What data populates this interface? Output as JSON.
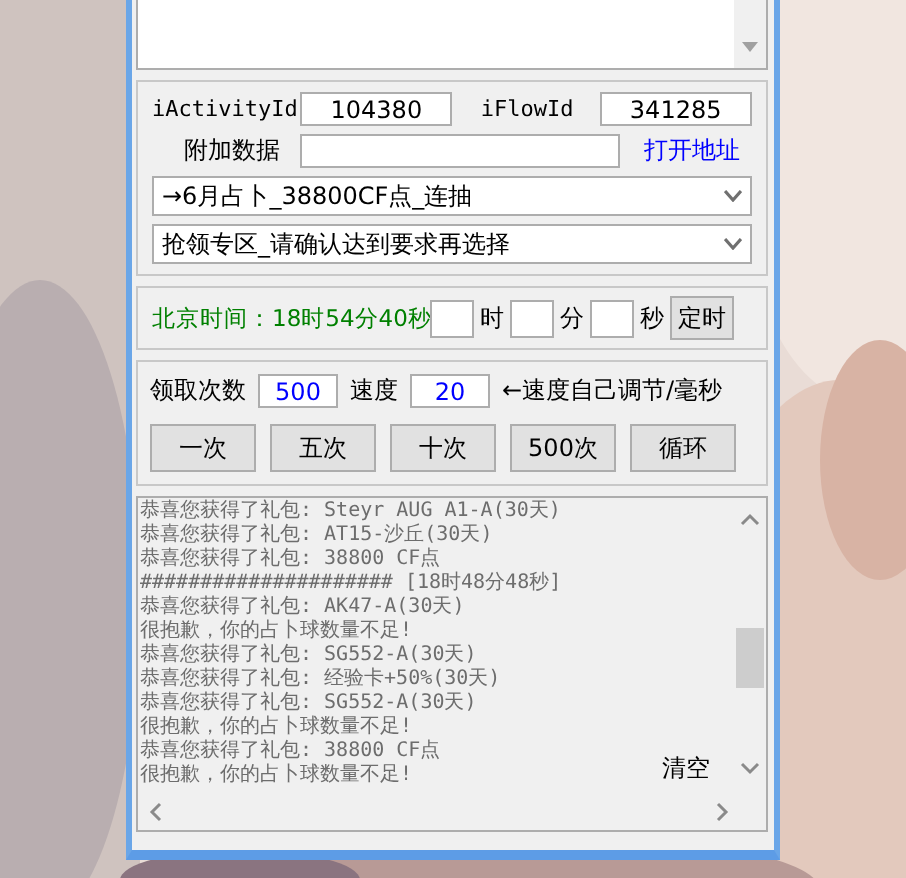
{
  "activity_row": {
    "activity_label": "iActivityId",
    "activity_value": "104380",
    "flow_label": "iFlowId",
    "flow_value": "341285"
  },
  "extra_row": {
    "label": "附加数据",
    "link": "打开地址"
  },
  "dropdowns": [
    "→6月占卜_38800CF点_连抽",
    "抢领专区_请确认达到要求再选择"
  ],
  "timer": {
    "clock": "北京时间：18时54分40秒",
    "units": [
      "时",
      "分",
      "秒"
    ],
    "button": "定时"
  },
  "claim": {
    "count_label": "领取次数",
    "count_value": "500",
    "speed_label": "速度",
    "speed_value": "20",
    "hint": "←速度自己调节/毫秒"
  },
  "buttons": [
    "一次",
    "五次",
    "十次",
    "500次",
    "循环"
  ],
  "log": {
    "lines": [
      "恭喜您获得了礼包:  Steyr AUG A1-A(30天)",
      "恭喜您获得了礼包:  AT15-沙丘(30天)",
      "恭喜您获得了礼包:  38800 CF点",
      "##################### [18时48分48秒]",
      "恭喜您获得了礼包:  AK47-A(30天)",
      "很抱歉，你的占卜球数量不足!",
      "恭喜您获得了礼包:  SG552-A(30天)",
      "恭喜您获得了礼包:  经验卡+50%(30天)",
      "恭喜您获得了礼包:  SG552-A(30天)",
      "很抱歉，你的占卜球数量不足!",
      "恭喜您获得了礼包:  38800 CF点",
      "很抱歉，你的占卜球数量不足!"
    ],
    "clear_button": "清空"
  }
}
